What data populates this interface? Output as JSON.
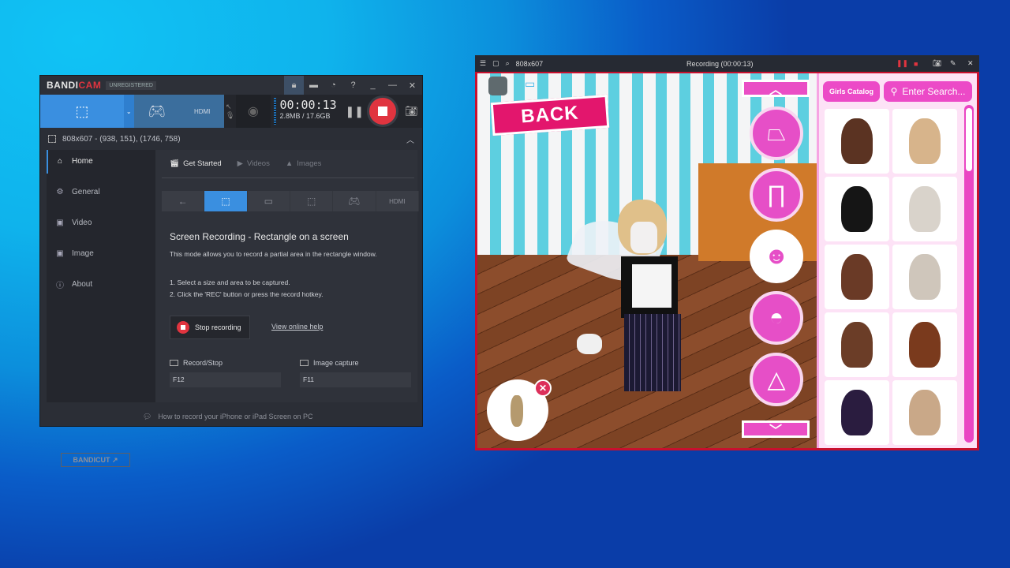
{
  "bandicam": {
    "logo_main": "BANDI",
    "logo_accent": "CAM",
    "badge": "UNREGISTERED",
    "timer": "00:00:13",
    "size": "2.8MB / 17.6GB",
    "region": "808x607 - (938, 151), (1746, 758)",
    "sidebar": [
      {
        "label": "Home",
        "icon": "home-icon"
      },
      {
        "label": "General",
        "icon": "gear-icon"
      },
      {
        "label": "Video",
        "icon": "video-settings-icon"
      },
      {
        "label": "Image",
        "icon": "image-settings-icon"
      },
      {
        "label": "About",
        "icon": "info-icon"
      }
    ],
    "tabs": [
      {
        "label": "Get Started"
      },
      {
        "label": "Videos"
      },
      {
        "label": "Images"
      }
    ],
    "heading": "Screen Recording - Rectangle on a screen",
    "description": "This mode allows you to record a partial area in the rectangle window.",
    "step1": "1. Select a size and area to be captured.",
    "step2": "2. Click the 'REC' button or press the record hotkey.",
    "stop_label": "Stop recording",
    "help_link": "View online help",
    "hotkey_record_label": "Record/Stop",
    "hotkey_record_value": "F12",
    "hotkey_image_label": "Image capture",
    "hotkey_image_value": "F11",
    "bandicut": "BANDICUT",
    "footer": "How to record your iPhone or iPad Screen on PC"
  },
  "recorder": {
    "size": "808x607",
    "status": "Recording (00:00:13)"
  },
  "game": {
    "back_label": "BACK",
    "catalog_label": "Girls Catalog",
    "search_placeholder": "Enter Search...",
    "categories": [
      "skirt",
      "pants",
      "hair",
      "hat",
      "hood"
    ],
    "items": [
      {
        "color": "#5b3322"
      },
      {
        "color": "#d7b48b"
      },
      {
        "color": "#151515"
      },
      {
        "color": "#d9d3cb"
      },
      {
        "color": "#6a3a26"
      },
      {
        "color": "#cfc6bb"
      },
      {
        "color": "#6b3d27"
      },
      {
        "color": "#7a3a1d"
      },
      {
        "color": "#2a1c3f"
      },
      {
        "color": "#c9a888"
      }
    ]
  },
  "colors": {
    "accent": "#ea4ec5",
    "rec_red": "#e0343f",
    "bandicam_blue": "#3a8fe0"
  }
}
